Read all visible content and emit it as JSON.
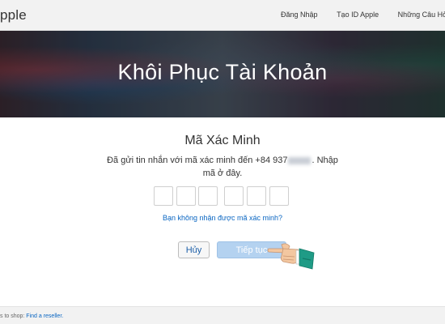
{
  "nav": {
    "brand": "pple",
    "links": [
      "Đăng Nhập",
      "Tạo ID Apple",
      "Những Câu Hỏi Thường Gặp"
    ]
  },
  "hero": {
    "title": "Khôi Phục Tài Khoản"
  },
  "verify": {
    "heading": "Mã Xác Minh",
    "desc_part1": "Đã gửi tin nhắn với mã xác minh đến +84 937",
    "desc_part2": ". Nhập mã ở đây.",
    "digit_count": 6,
    "resend_link": "Bạn không nhận được mã xác minh?"
  },
  "buttons": {
    "cancel": "Hủy",
    "next": "Tiếp tục"
  },
  "footer": {
    "text": "s to shop: ",
    "link": "Find a reseller."
  },
  "colors": {
    "link": "#0a66c2",
    "next_button_bg": "#b4d2f0",
    "hand_sleeve": "#1f9b86",
    "hand_skin": "#f3c7a0"
  }
}
